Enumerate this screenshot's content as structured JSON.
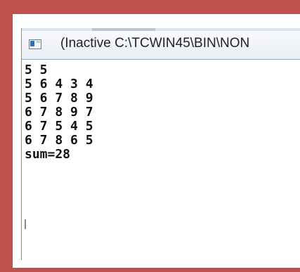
{
  "window": {
    "title": "(Inactive C:\\TCWIN45\\BIN\\NON"
  },
  "console": {
    "lines": [
      "5 5",
      "5 6 4 3 4",
      "5 6 7 8 9",
      "6 7 8 9 7",
      "6 7 5 4 5",
      "6 7 8 6 5",
      "sum=28"
    ]
  },
  "colors": {
    "border_accent": "#c0504d",
    "titlebar": "#e9eef5",
    "text": "#111111"
  },
  "icons": {
    "app": "console-window-icon"
  }
}
